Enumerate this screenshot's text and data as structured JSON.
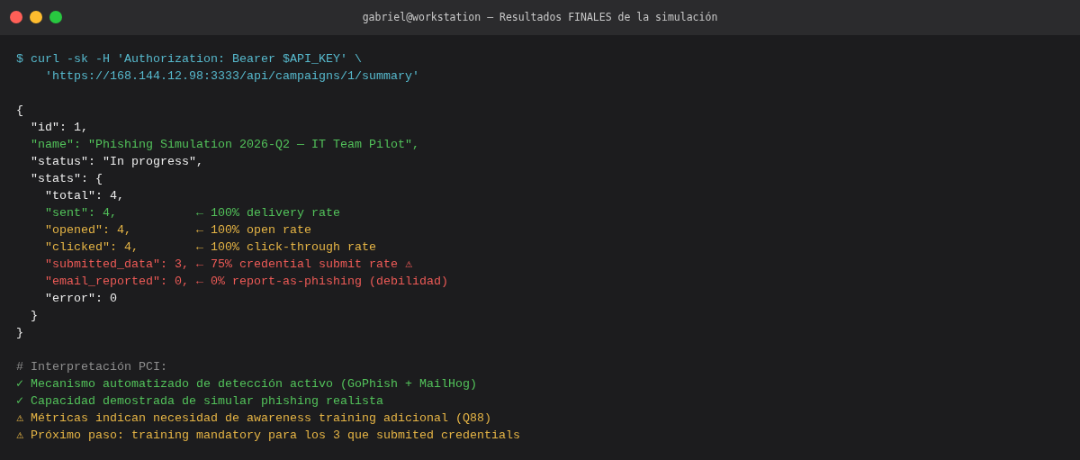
{
  "window": {
    "title": "gabriel@workstation — Resultados FINALES de la simulación"
  },
  "blocks": [
    {
      "lines": [
        {
          "kind": "command",
          "text": "$ curl -sk -H 'Authorization: Bearer $API_KEY' \\"
        },
        {
          "kind": "command",
          "text": "    'https://168.144.12.98:3333/api/campaigns/1/summary'"
        }
      ]
    },
    {
      "lines": [
        {
          "kind": "plain",
          "text": "{"
        },
        {
          "kind": "plain",
          "text": "  \"id\": 1,"
        },
        {
          "kind": "success",
          "text": "  \"name\": \"Phishing Simulation 2026-Q2 — IT Team Pilot\","
        },
        {
          "kind": "plain",
          "text": "  \"status\": \"In progress\","
        },
        {
          "kind": "plain",
          "text": "  \"stats\": {"
        },
        {
          "kind": "plain",
          "text": "    \"total\": 4,"
        },
        {
          "kind": "success",
          "text": "    \"sent\": 4,           ← 100% delivery rate"
        },
        {
          "kind": "warning",
          "text": "    \"opened\": 4,         ← 100% open rate"
        },
        {
          "kind": "warning",
          "text": "    \"clicked\": 4,        ← 100% click-through rate"
        },
        {
          "kind": "danger",
          "text": "    \"submitted_data\": 3, ← 75% credential submit rate ⚠"
        },
        {
          "kind": "danger",
          "text": "    \"email_reported\": 0, ← 0% report-as-phishing (debilidad)"
        },
        {
          "kind": "plain",
          "text": "    \"error\": 0"
        },
        {
          "kind": "plain",
          "text": "  }"
        },
        {
          "kind": "plain",
          "text": "}"
        }
      ]
    },
    {
      "lines": [
        {
          "kind": "comment",
          "text": "# Interpretación PCI:"
        },
        {
          "kind": "success",
          "text": "✓ Mecanismo automatizado de detección activo (GoPhish + MailHog)"
        },
        {
          "kind": "success",
          "text": "✓ Capacidad demostrada de simular phishing realista"
        },
        {
          "kind": "warning",
          "text": "⚠ Métricas indican necesidad de awareness training adicional (Q88)"
        },
        {
          "kind": "warning",
          "text": "⚠ Próximo paso: training mandatory para los 3 que submited credentials"
        }
      ]
    }
  ]
}
